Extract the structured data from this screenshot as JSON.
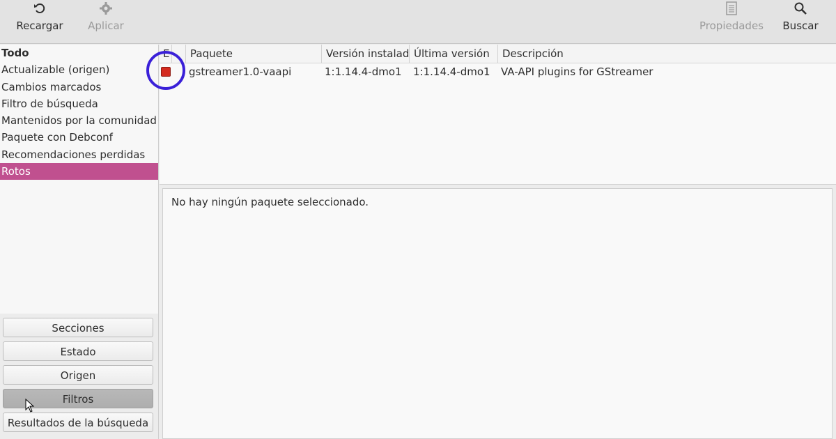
{
  "toolbar": {
    "reload_label": "Recargar",
    "reload_icon": "reload-icon",
    "apply_label": "Aplicar",
    "apply_icon": "gear-icon",
    "properties_label": "Propiedades",
    "properties_icon": "properties-icon",
    "search_label": "Buscar",
    "search_icon": "search-icon"
  },
  "sidebar": {
    "filters": [
      "Todo",
      "Actualizable (origen)",
      "Cambios marcados",
      "Filtro de búsqueda",
      "Mantenidos por la comunidad (in",
      "Paquete con Debconf",
      "Recomendaciones perdidas",
      "Rotos"
    ],
    "selected": "Rotos",
    "buttons": [
      "Secciones",
      "Estado",
      "Origen",
      "Filtros",
      "Resultados de la búsqueda"
    ],
    "active_button": "Filtros"
  },
  "table": {
    "columns": [
      "E",
      "",
      "Paquete",
      "Versión instalada",
      "Última versión",
      "Descripción"
    ],
    "rows": [
      {
        "status": "broken",
        "package": "gstreamer1.0-vaapi",
        "installed": "1:1.14.4-dmo1",
        "latest": "1:1.14.4-dmo1",
        "description": "VA-API plugins for GStreamer"
      }
    ]
  },
  "details": {
    "text": "No hay ningún paquete seleccionado."
  },
  "colors": {
    "selection": "#c0508f",
    "broken_status": "#d42a1f",
    "highlight_circle": "#3a20d8"
  }
}
